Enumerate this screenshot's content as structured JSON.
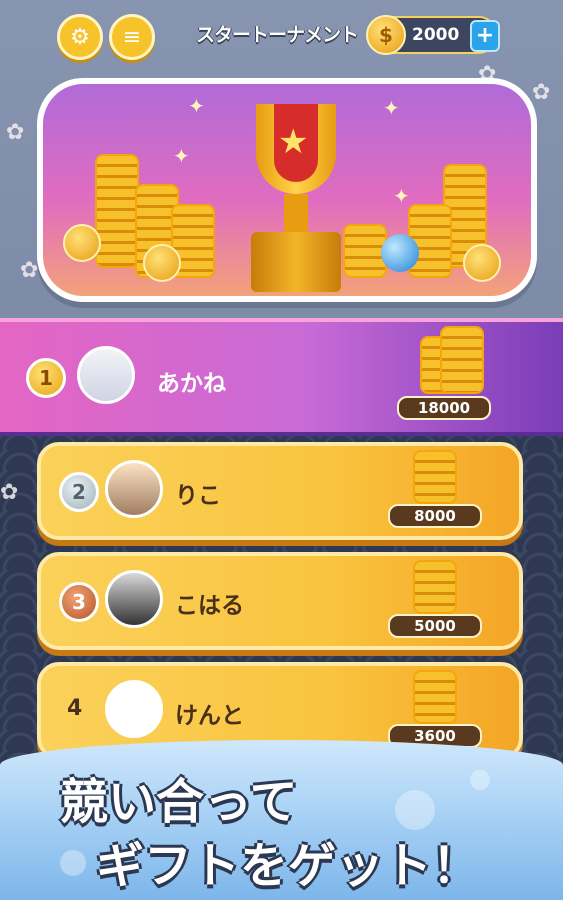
{
  "header": {
    "title": "スタートーナメント",
    "coins": "2000",
    "coin_symbol": "$",
    "plus_label": "+",
    "settings_icon": "gear-icon",
    "menu_icon": "menu-icon"
  },
  "banner": {
    "image": "trophy-with-coins"
  },
  "leaderboard": [
    {
      "rank": "1",
      "name": "あかね",
      "prize": "18000"
    },
    {
      "rank": "2",
      "name": "りこ",
      "prize": "8000"
    },
    {
      "rank": "3",
      "name": "こはる",
      "prize": "5000"
    },
    {
      "rank": "4",
      "name": "けんと",
      "prize": "3600"
    }
  ],
  "promo": {
    "line1": "競い合って",
    "line2": "ギフトをゲット！"
  },
  "colors": {
    "gold": "#f9c43f",
    "purple": "#c86ad6",
    "navy": "#2e3852"
  }
}
